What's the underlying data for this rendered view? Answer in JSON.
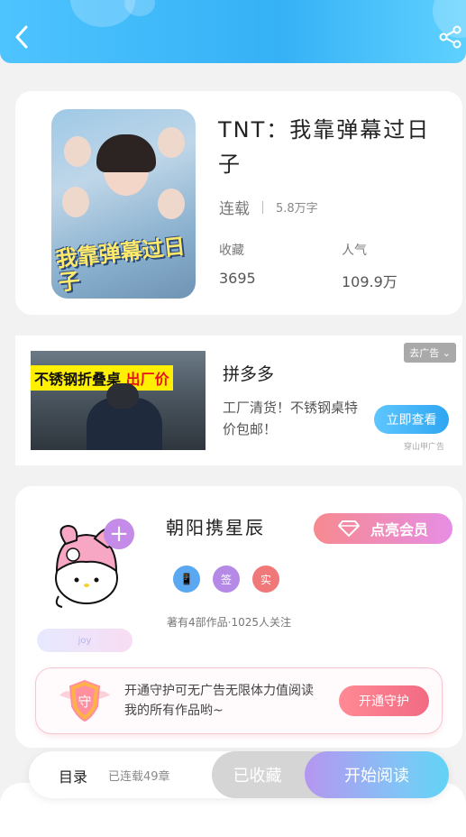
{
  "header": {
    "back_icon": "chevron-left-icon",
    "share_icon": "share-icon",
    "gradient": [
      "#4ec4ff",
      "#35b1f5",
      "#5fd1ff"
    ]
  },
  "book": {
    "title": "TNT：我靠弹幕过日子",
    "cover_title": "我靠弹幕过日子",
    "status": "连载",
    "word_count": "5.8万字",
    "collect_label": "收藏",
    "collect_value": "3695",
    "popularity_label": "人气",
    "popularity_value": "109.9万"
  },
  "ad": {
    "banner_text": "不锈钢折叠桌",
    "banner_highlight": "出厂价",
    "brand": "拼多多",
    "description": "工厂清货！不锈钢桌特价包邮！",
    "close_label": "去广告",
    "cta_label": "立即查看",
    "source": "穿山甲广告"
  },
  "author": {
    "name": "朝阳携星辰",
    "vip_label": "点亮会员",
    "nameplate": "joy",
    "badges": [
      "📱",
      "签",
      "实"
    ],
    "badge_colors": [
      "#5aa7f2",
      "#b48ae6",
      "#f07878"
    ],
    "stats": "著有4部作品·1025人关注",
    "guard_text": "开通守护可无广告无限体力值阅读我的所有作品哟~",
    "guard_btn": "开通守护",
    "shield_char": "守"
  },
  "bottom": {
    "toc_label": "目录",
    "chapter_status": "已连载49章",
    "collected_label": "已收藏",
    "read_label": "开始阅读"
  }
}
